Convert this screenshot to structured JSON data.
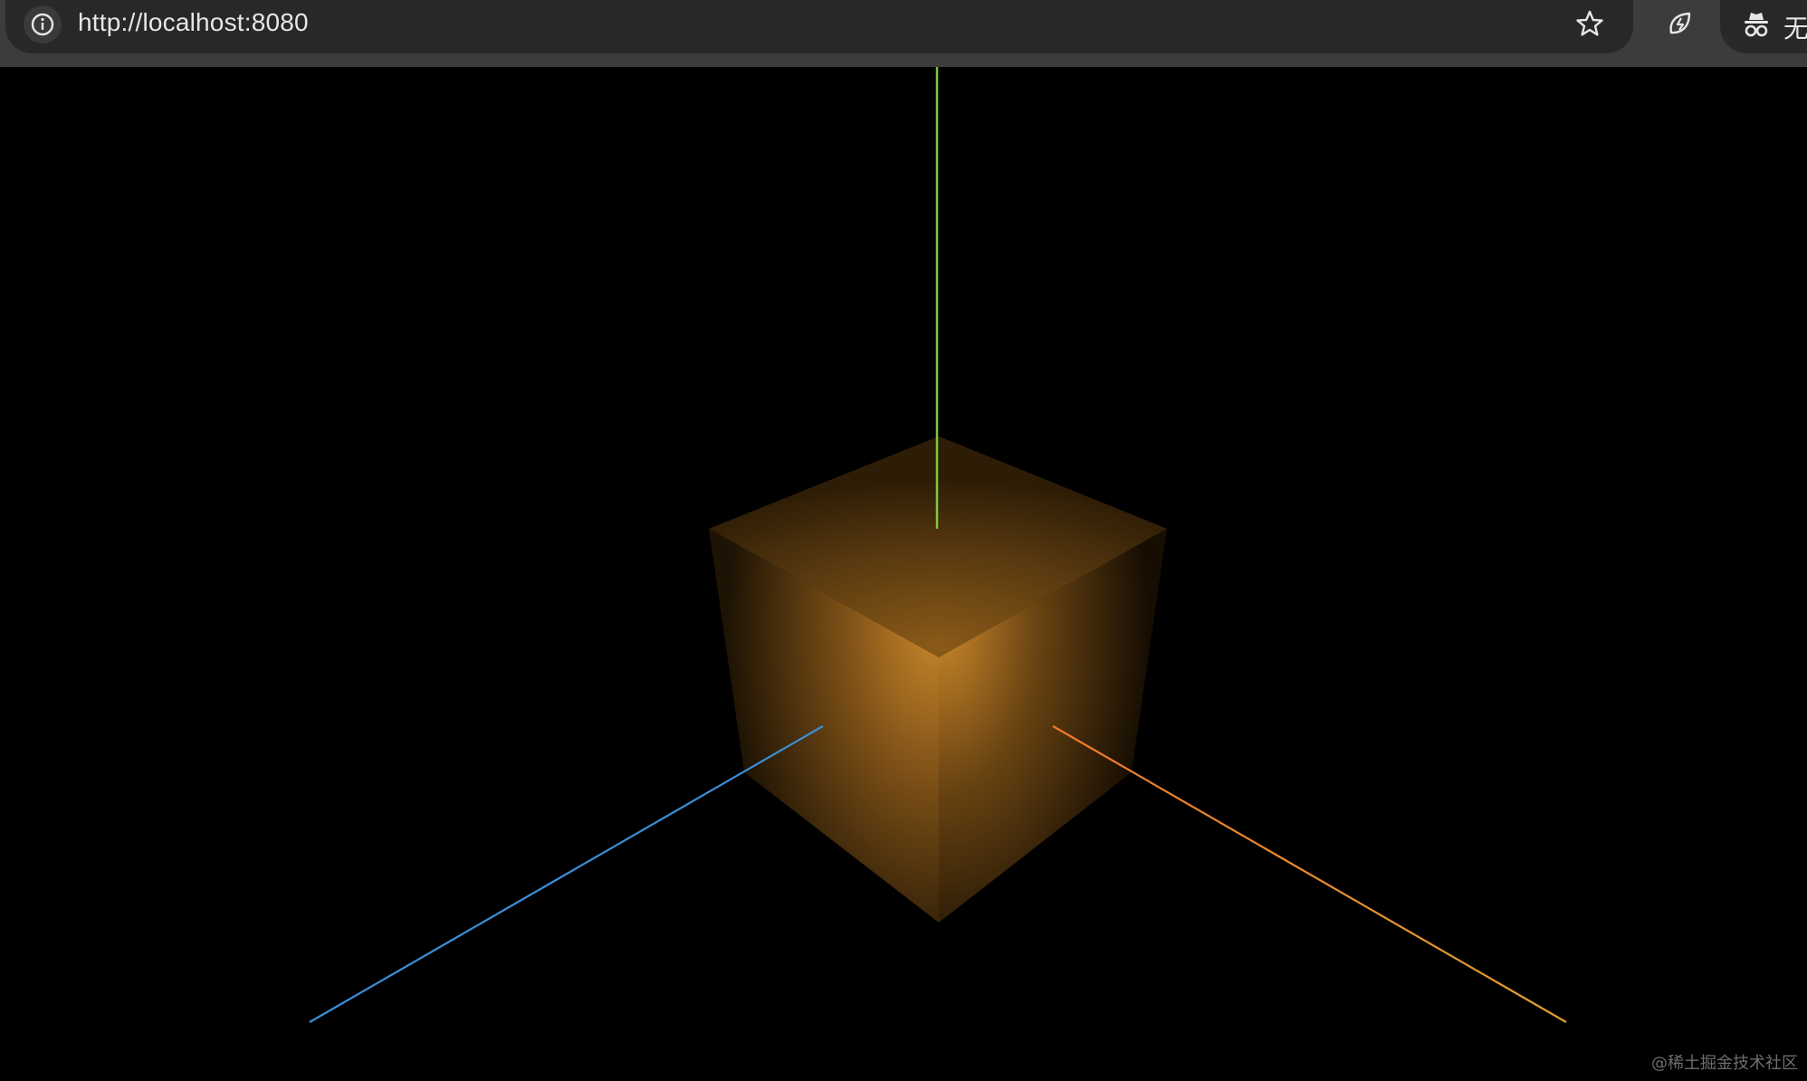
{
  "browser": {
    "url": "http://localhost:8080",
    "profile_label": "无",
    "icons": {
      "info": "info-icon",
      "bookmark": "star-icon",
      "extension": "leaf-bolt-icon",
      "profile": "incognito-icon"
    },
    "colors": {
      "toolbar": "#3c3c3c",
      "address_bar": "#282828",
      "text": "#e6e6e6"
    }
  },
  "scene": {
    "background": "#000000",
    "cube_color": "#c8862a",
    "axes": [
      {
        "name": "y",
        "color": "#7ec83a"
      },
      {
        "name": "z",
        "color": "#3a8fd8"
      },
      {
        "name": "x",
        "color": "#f08a28"
      }
    ]
  },
  "watermark": "@稀土掘金技术社区"
}
